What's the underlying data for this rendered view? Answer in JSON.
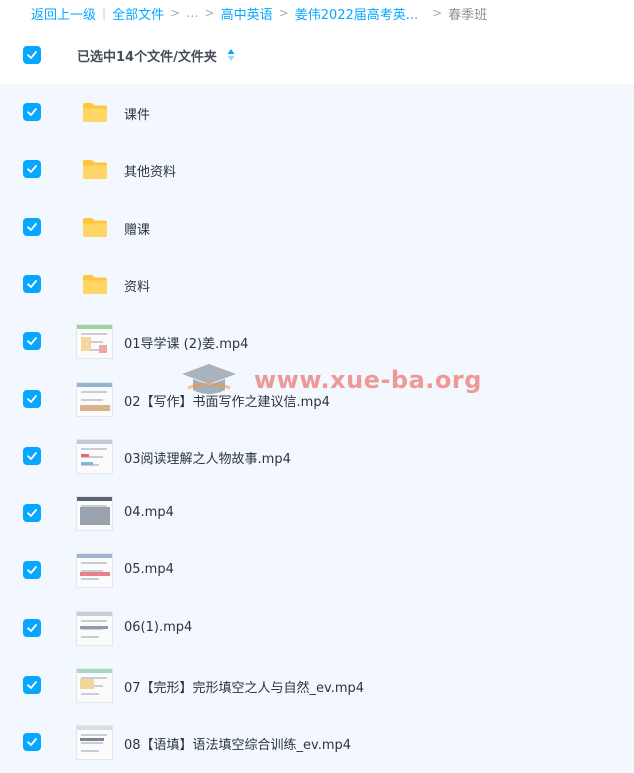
{
  "breadcrumb": {
    "back": "返回上一级",
    "divider": "|",
    "all_files": "全部文件",
    "sep": ">",
    "ellipsis": "...",
    "level1": "高中英语",
    "level2": "姜伟2022届高考英...",
    "current": "春季班"
  },
  "selection": {
    "text": "已选中14个文件/文件夹"
  },
  "colors": {
    "accent": "#06a7ff",
    "folder": "#ffcd3c",
    "list_bg": "#f2f8fe"
  },
  "files": [
    {
      "name": "课件",
      "type": "folder",
      "icon": "folder-icon",
      "checked": true
    },
    {
      "name": "其他资料",
      "type": "folder",
      "icon": "folder-icon",
      "checked": true
    },
    {
      "name": "赠课",
      "type": "folder",
      "icon": "folder-icon",
      "checked": true
    },
    {
      "name": "资料",
      "type": "folder",
      "icon": "folder-icon",
      "checked": true
    },
    {
      "name": "01导学课 (2)姜.mp4",
      "type": "video",
      "icon": "video-thumbnail",
      "checked": true
    },
    {
      "name": "02【写作】书面写作之建议信.mp4",
      "type": "video",
      "icon": "video-thumbnail",
      "checked": true
    },
    {
      "name": "03阅读理解之人物故事.mp4",
      "type": "video",
      "icon": "video-thumbnail",
      "checked": true
    },
    {
      "name": "04.mp4",
      "type": "video",
      "icon": "video-thumbnail",
      "checked": true
    },
    {
      "name": "05.mp4",
      "type": "video",
      "icon": "video-thumbnail",
      "checked": true
    },
    {
      "name": "06(1).mp4",
      "type": "video",
      "icon": "video-thumbnail",
      "checked": true
    },
    {
      "name": "07【完形】完形填空之人与自然_ev.mp4",
      "type": "video",
      "icon": "video-thumbnail",
      "checked": true
    },
    {
      "name": "08【语填】语法填空综合训练_ev.mp4",
      "type": "video",
      "icon": "video-thumbnail",
      "checked": true
    }
  ],
  "watermark": {
    "text": "www.xue-ba.org",
    "icon": "graduation-cap-icon"
  }
}
